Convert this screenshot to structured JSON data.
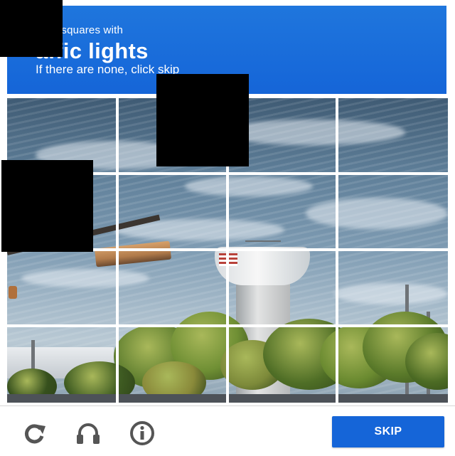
{
  "challenge": {
    "instruction_line1": "ct all squares with",
    "instruction_line2": "affic lights",
    "instruction_line3": "If there are none, click skip",
    "header_color": "#1565d8"
  },
  "grid": {
    "rows": 4,
    "cols": 4,
    "tiles": [
      {
        "row": 0,
        "col": 0,
        "selected": false
      },
      {
        "row": 0,
        "col": 1,
        "selected": false
      },
      {
        "row": 0,
        "col": 2,
        "selected": false
      },
      {
        "row": 0,
        "col": 3,
        "selected": false
      },
      {
        "row": 1,
        "col": 0,
        "selected": false
      },
      {
        "row": 1,
        "col": 1,
        "selected": false
      },
      {
        "row": 1,
        "col": 2,
        "selected": false
      },
      {
        "row": 1,
        "col": 3,
        "selected": false
      },
      {
        "row": 2,
        "col": 0,
        "selected": false
      },
      {
        "row": 2,
        "col": 1,
        "selected": false
      },
      {
        "row": 2,
        "col": 2,
        "selected": false
      },
      {
        "row": 2,
        "col": 3,
        "selected": false
      },
      {
        "row": 3,
        "col": 0,
        "selected": false
      },
      {
        "row": 3,
        "col": 1,
        "selected": false
      },
      {
        "row": 3,
        "col": 2,
        "selected": false
      },
      {
        "row": 3,
        "col": 3,
        "selected": false
      }
    ]
  },
  "footer": {
    "reload_icon": "reload-icon",
    "audio_icon": "headphones-icon",
    "info_icon": "info-icon",
    "skip_label": "SKIP",
    "icon_color": "#555555",
    "button_color": "#1565d8"
  }
}
